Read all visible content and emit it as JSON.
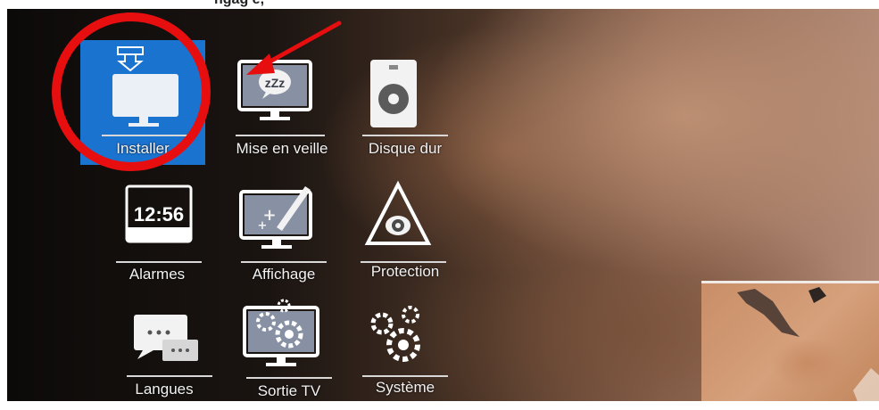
{
  "top_partial_text": "ngag e, ",
  "menu": {
    "items": [
      {
        "label": "Installer",
        "icon": "monitor-download-icon",
        "selected": true
      },
      {
        "label": "Mise en veille",
        "icon": "monitor-sleep-icon"
      },
      {
        "label": "Disque dur",
        "icon": "hard-disk-icon"
      },
      {
        "label": "Alarmes",
        "icon": "clock-display-icon",
        "clock_text": "12:56"
      },
      {
        "label": "Affichage",
        "icon": "monitor-pen-icon"
      },
      {
        "label": "Protection",
        "icon": "protection-eye-icon"
      },
      {
        "label": "Langues",
        "icon": "chat-bubbles-icon"
      },
      {
        "label": "Sortie TV",
        "icon": "monitor-gears-icon"
      },
      {
        "label": "Système",
        "icon": "gears-icon"
      }
    ]
  },
  "sleep_icon_text": "zZz",
  "colors": {
    "selected_tile": "#1b73d0",
    "annotation_red": "#e60e0e"
  }
}
